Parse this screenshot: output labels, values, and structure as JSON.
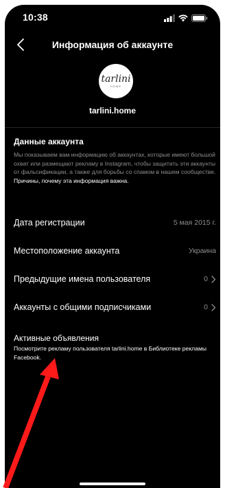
{
  "status_bar": {
    "time": "10:38"
  },
  "header": {
    "title": "Информация об аккаунте"
  },
  "profile": {
    "username": "tarlini.home",
    "logo_text": "tarlini",
    "logo_sub": "HOME"
  },
  "account_data": {
    "title": "Данные аккаунта",
    "description": "Мы показываем вам информацию об аккаунтах, которые имеют большой охват или размещают рекламу в Instagram, чтобы защитить эти аккаунты от фальсификации, а также для борьбы со спамом в нашем сообществе.",
    "link": "Причины, почему эта информация важна."
  },
  "rows": [
    {
      "label": "Дата регистрации",
      "value": "5 мая 2015 г."
    },
    {
      "label": "Местоположение аккаунта",
      "value": "Украина"
    },
    {
      "label": "Предыдущие имена пользователя",
      "value": "0"
    },
    {
      "label": "Аккаунты с общими подписчиками",
      "value": "0"
    }
  ],
  "active_ads": {
    "label": "Активные объявления",
    "subtext": "Посмотрите рекламу пользователя tarlini.home в Библиотеке рекламы Facebook."
  },
  "colors": {
    "background": "#000000",
    "secondary_text": "#8e8e8e",
    "annotation_arrow": "#ff1a1a"
  }
}
